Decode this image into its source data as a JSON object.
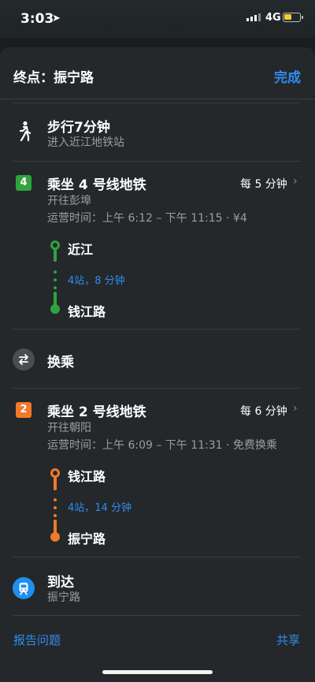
{
  "status": {
    "time": "3:03",
    "network": "4G"
  },
  "header": {
    "title": "终点：振宁路",
    "done": "完成"
  },
  "steps": {
    "walk": {
      "title": "步行7分钟",
      "subtitle": "进入近江地铁站"
    },
    "line4": {
      "badge": "4",
      "title": "乘坐 4 号线地铁",
      "frequency": "每 5 分钟",
      "direction": "开往彭埠",
      "hours": "运营时间：上午 6:12 – 下午 11:15 · ¥4",
      "from": "近江",
      "stops": "4站，8 分钟",
      "to": "钱江路"
    },
    "transfer": {
      "title": "换乘"
    },
    "line2": {
      "badge": "2",
      "title": "乘坐 2 号线地铁",
      "frequency": "每 6 分钟",
      "direction": "开往朝阳",
      "hours": "运营时间：上午 6:09 – 下午 11:31 · 免费换乘",
      "from": "钱江路",
      "stops": "4站，14 分钟",
      "to": "振宁路"
    },
    "arrive": {
      "title": "到达",
      "subtitle": "振宁路"
    }
  },
  "footer": {
    "report": "报告问题",
    "share": "共享"
  },
  "icons": {
    "location": "location-arrow-icon",
    "walk": "walk-icon",
    "transfer": "transfer-icon",
    "arrive": "train-icon",
    "chevron": "chevron-right-icon"
  },
  "colors": {
    "accent": "#2f8cf3",
    "line4": "#2fa33f",
    "line2": "#f07a2a",
    "background": "#24282a"
  }
}
